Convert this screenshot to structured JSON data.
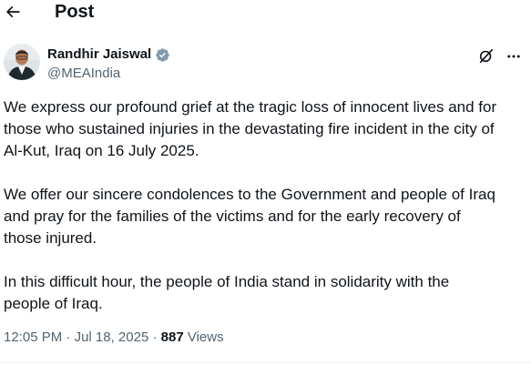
{
  "header": {
    "title": "Post",
    "back_icon": "arrow-left-icon"
  },
  "author": {
    "display_name": "Randhir Jaiswal",
    "handle": "@MEAIndia",
    "verified_color": "#829aab",
    "verified_icon": "verified-badge-icon"
  },
  "actions": {
    "grok_icon": "grok-icon",
    "more_icon": "more-icon"
  },
  "post": {
    "paragraphs": [
      "We express our profound grief at the tragic loss of innocent lives and for\nthose who sustained injuries in the devastating fire incident in the city of\nAl-Kut, Iraq on 16 July 2025.",
      "We offer our sincere condolences to the Government and people of Iraq\nand pray for the families of the victims and for the early recovery of\nthose injured.",
      "In this difficult hour, the people of India stand in solidarity with the\npeople of Iraq."
    ]
  },
  "meta": {
    "time": "12:05 PM",
    "separator1": " · ",
    "date": "Jul 18, 2025",
    "separator2": " · ",
    "views_count": "887",
    "views_label": " Views"
  },
  "colors": {
    "text_primary": "#0f1419",
    "text_secondary": "#536471"
  }
}
